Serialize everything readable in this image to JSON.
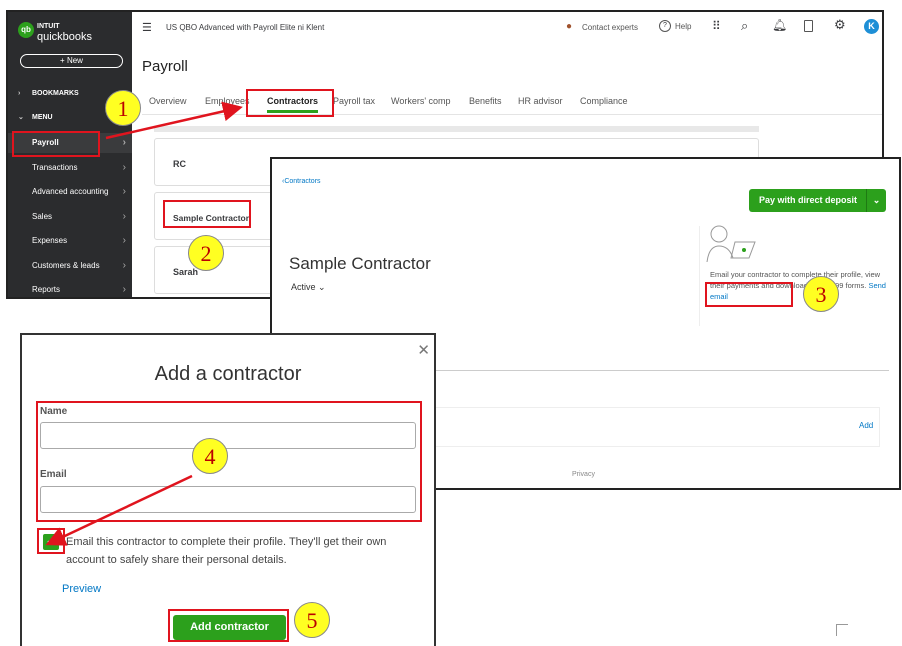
{
  "app": {
    "brand_top": "INTUIT",
    "brand": "quickbooks",
    "logo_mark": "qb",
    "company": "US QBO Advanced with Payroll Elite ni Klent",
    "new_button": "+ New",
    "topbar": {
      "contact": "Contact experts",
      "help": "Help",
      "avatar": "K"
    },
    "sidebar": {
      "bookmarks": "BOOKMARKS",
      "menu": "MENU",
      "items": [
        {
          "label": "Payroll"
        },
        {
          "label": "Transactions"
        },
        {
          "label": "Advanced accounting"
        },
        {
          "label": "Sales"
        },
        {
          "label": "Expenses"
        },
        {
          "label": "Customers & leads"
        },
        {
          "label": "Reports"
        }
      ]
    },
    "page_title": "Payroll",
    "tabs": [
      {
        "label": "Overview"
      },
      {
        "label": "Employees"
      },
      {
        "label": "Contractors",
        "active": true
      },
      {
        "label": "Payroll tax"
      },
      {
        "label": "Workers' comp"
      },
      {
        "label": "Benefits"
      },
      {
        "label": "HR advisor"
      },
      {
        "label": "Compliance"
      }
    ],
    "contractors": [
      {
        "name": "RC"
      },
      {
        "name": "Sample Contractor"
      },
      {
        "name": "Sarah"
      }
    ]
  },
  "detail": {
    "back_link": "Contractors",
    "name": "Sample Contractor",
    "status": "Active",
    "pay_button": "Pay with direct deposit",
    "promo_text": "Email your contractor to complete their profile, view their payments and download their 1099 forms.",
    "send_email": "Send email",
    "add_link": "Add",
    "privacy": "Privacy"
  },
  "dialog": {
    "title": "Add a contractor",
    "name_label": "Name",
    "name_value": "",
    "email_label": "Email",
    "email_value": "",
    "checkbox_checked": true,
    "checkbox_text": "Email this contractor to complete their profile. They'll get their own account to safely share their personal details.",
    "preview": "Preview",
    "submit": "Add contractor"
  },
  "callouts": [
    "1",
    "2",
    "3",
    "4",
    "5"
  ],
  "colors": {
    "accent_green": "#2ca01c",
    "annotation_red": "#e0141e",
    "callout_yellow": "#ffff22",
    "link_blue": "#0077c5"
  }
}
